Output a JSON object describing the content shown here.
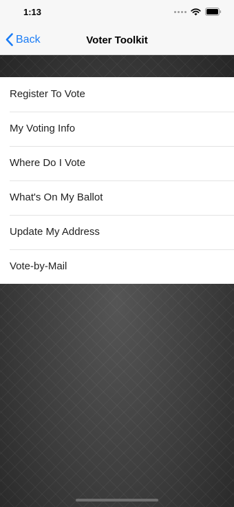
{
  "status_bar": {
    "time": "1:13",
    "wifi_icon": "wifi-icon",
    "battery_icon": "battery-icon"
  },
  "nav": {
    "back_label": "Back",
    "back_icon": "chevron-left-icon",
    "title": "Voter Toolkit",
    "accent_color": "#1a7cf5"
  },
  "menu": {
    "items": [
      {
        "label": "Register To Vote"
      },
      {
        "label": "My Voting Info"
      },
      {
        "label": "Where Do I Vote"
      },
      {
        "label": "What's On My Ballot"
      },
      {
        "label": "Update My Address"
      },
      {
        "label": "Vote-by-Mail"
      }
    ]
  },
  "colors": {
    "background_pattern": "#3a3a3a",
    "list_background": "#ffffff"
  }
}
